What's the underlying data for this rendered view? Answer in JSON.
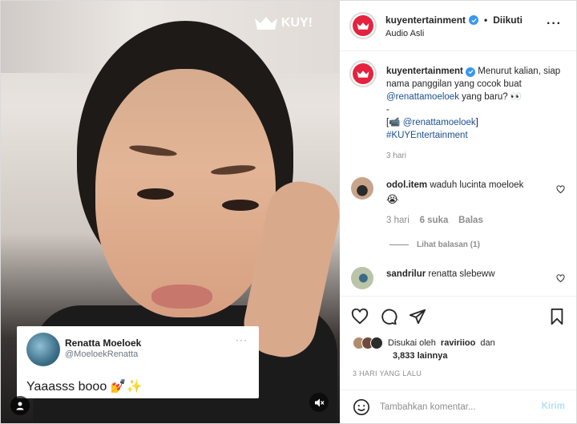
{
  "video": {
    "logo_text": "KUY!",
    "tweet": {
      "name": "Renatta Moeloek",
      "handle": "@MoeloekRenatta",
      "more": "···",
      "text": "Yaaasss booo 💅✨"
    }
  },
  "header": {
    "username": "kuyentertainment",
    "separator": "•",
    "follow_status": "Diikuti",
    "audio": "Audio Asli",
    "options": "···"
  },
  "caption": {
    "username": "kuyentertainment",
    "line1": "Menurut kalian, siap nama panggilan yang cocok buat",
    "mention": "@renattamoeloek",
    "line2": "yang baru? 👀",
    "dash": "-",
    "credit_prefix": "[📹",
    "credit_mention": "@renattamoeloek",
    "credit_suffix": "]",
    "hashtag": "#KUYEntertainment",
    "time": "3 hari"
  },
  "comments": [
    {
      "username": "odol.item",
      "text": "waduh lucinta moeloek",
      "emoji": "😭",
      "time": "3 hari",
      "likes": "6 suka",
      "reply": "Balas",
      "view_replies": "Lihat balasan (1)"
    },
    {
      "username": "sandrilur",
      "text": "renatta slebeww"
    }
  ],
  "actions": {
    "liked_prefix": "Disukai oleh",
    "liked_user": "raviriioo",
    "liked_and": "dan",
    "liked_count": "3,833 lainnya",
    "date": "3 HARI YANG LALU"
  },
  "composer": {
    "placeholder": "Tambahkan komentar...",
    "post_label": "Kirim"
  },
  "colors": {
    "brand_red": "#e5233f",
    "verified_blue": "#3897f0",
    "link_blue": "#1b4f8f",
    "post_disabled": "#b2dffc"
  }
}
